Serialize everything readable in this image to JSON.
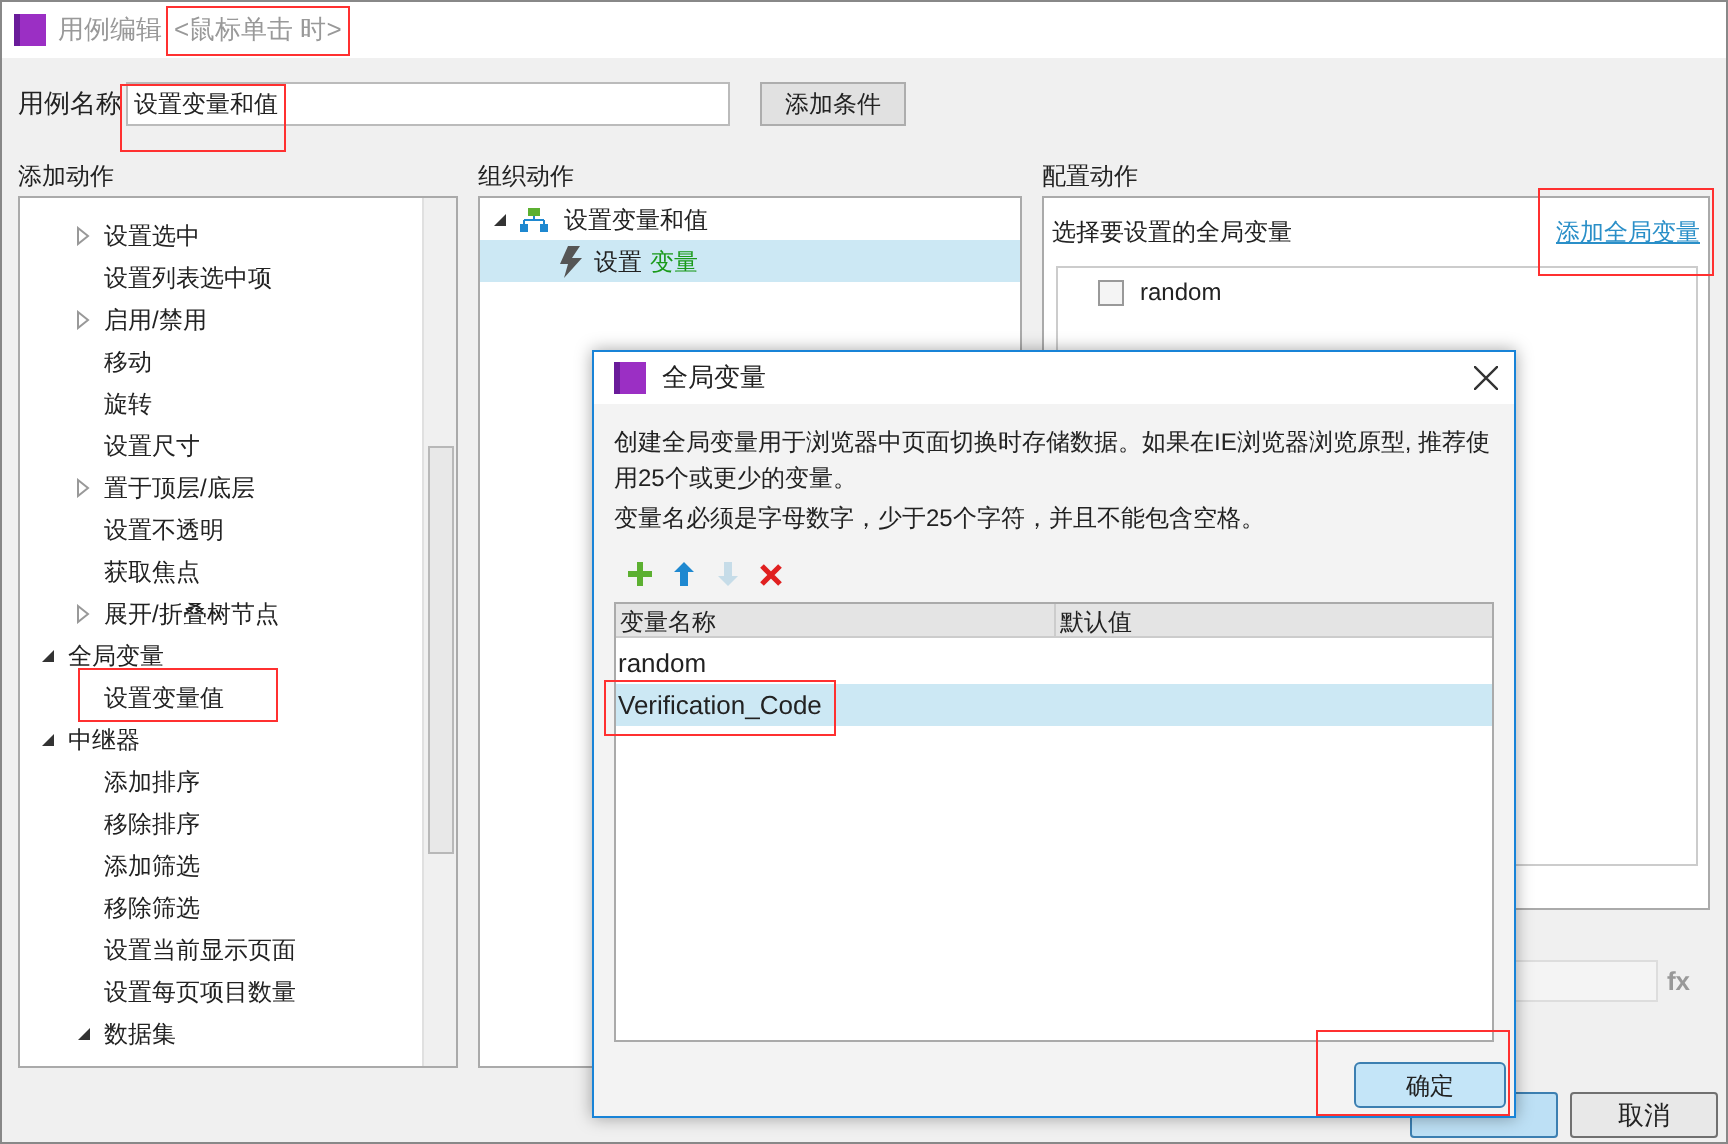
{
  "window": {
    "title": "用例编辑",
    "event": "<鼠标单击 时>"
  },
  "case_name": {
    "label": "用例名称",
    "value": "设置变量和值"
  },
  "add_condition_button": "添加条件",
  "add_actions": {
    "label": "添加动作",
    "partial_children": [
      {
        "label": "设置选中",
        "expanded": false
      },
      {
        "label": "设置列表选中项"
      },
      {
        "label": "启用/禁用",
        "expanded": false
      },
      {
        "label": "移动"
      },
      {
        "label": "旋转"
      },
      {
        "label": "设置尺寸"
      },
      {
        "label": "置于顶层/底层",
        "expanded": false
      },
      {
        "label": "设置不透明"
      },
      {
        "label": "获取焦点"
      },
      {
        "label": "展开/折叠树节点",
        "expanded": false
      }
    ],
    "groups": [
      {
        "label": "全局变量",
        "expanded": true,
        "children": [
          {
            "label": "设置变量值"
          }
        ]
      },
      {
        "label": "中继器",
        "expanded": true,
        "children": [
          {
            "label": "添加排序"
          },
          {
            "label": "移除排序"
          },
          {
            "label": "添加筛选"
          },
          {
            "label": "移除筛选"
          },
          {
            "label": "设置当前显示页面"
          },
          {
            "label": "设置每页项目数量"
          },
          {
            "label": "数据集",
            "expanded": true
          }
        ]
      }
    ]
  },
  "organize_actions": {
    "label": "组织动作",
    "case": {
      "label": "设置变量和值",
      "expanded": true,
      "children": [
        {
          "action": "设置",
          "target": "变量",
          "selected": true
        }
      ]
    }
  },
  "configure_actions": {
    "label": "配置动作",
    "prompt": "选择要设置的全局变量",
    "add_link": "添加全局变量",
    "variables": [
      {
        "name": "random",
        "checked": false
      }
    ],
    "formula_icon": "fx"
  },
  "buttons": [
    {
      "label": "取消"
    }
  ],
  "dialog": {
    "title": "全局变量",
    "description": "创建全局变量用于浏览器中页面切换时存储数据。如果在IE浏览器浏览原型, 推荐使用25个或更少的变量。",
    "rule": "变量名必须是字母数字，少于25个字符，并且不能包含空格。",
    "toolbar": [
      {
        "kind": "add",
        "disabled": false
      },
      {
        "kind": "up",
        "disabled": false
      },
      {
        "kind": "down",
        "disabled": true
      },
      {
        "kind": "delete",
        "disabled": false
      }
    ],
    "columns": [
      "变量名称",
      "默认值"
    ],
    "rows": [
      {
        "name": "random",
        "selected": false
      },
      {
        "name": "Verification_Code",
        "selected": true
      }
    ],
    "ok_button": "确定"
  }
}
